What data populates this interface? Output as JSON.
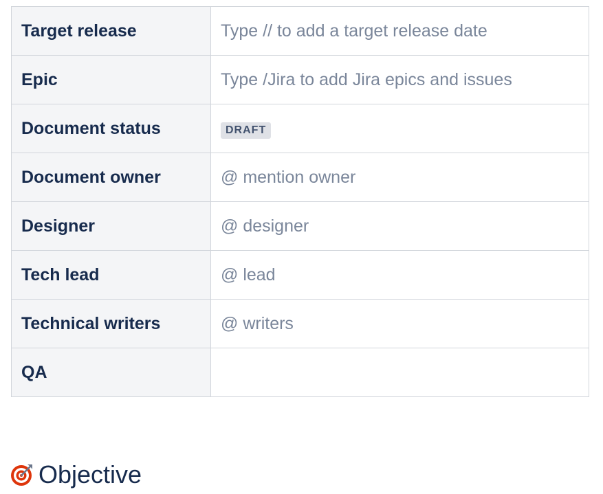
{
  "table": {
    "rows": [
      {
        "label": "Target release",
        "value": "Type // to add a target release date"
      },
      {
        "label": "Epic",
        "value": "Type /Jira to add Jira epics and issues"
      },
      {
        "label": "Document status",
        "status": "DRAFT"
      },
      {
        "label": "Document owner",
        "value": "@ mention owner"
      },
      {
        "label": "Designer",
        "value": "@ designer"
      },
      {
        "label": "Tech lead",
        "value": "@ lead"
      },
      {
        "label": "Technical writers",
        "value": "@ writers"
      },
      {
        "label": "QA",
        "value": ""
      }
    ]
  },
  "section": {
    "icon": "target-icon",
    "title": "Objective"
  },
  "colors": {
    "label_bg": "#f4f5f7",
    "label_text": "#172b4d",
    "placeholder_text": "#7a869a",
    "border": "#d1d5db",
    "lozenge_bg": "#dfe1e6",
    "lozenge_text": "#42526e",
    "target_red": "#de350b"
  }
}
